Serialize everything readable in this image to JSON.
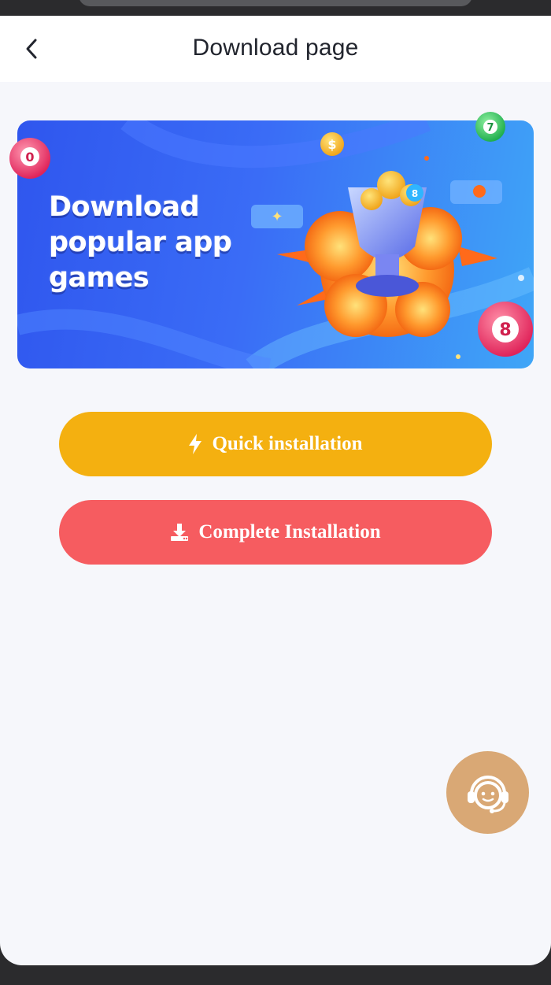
{
  "header": {
    "title": "Download page",
    "back_icon": "chevron-left-icon"
  },
  "banner": {
    "line1": "Download",
    "line2": "popular app",
    "line3": "games",
    "ball_left_number": "0",
    "ball_top_number": "7",
    "ball_right_number": "8",
    "coin_symbol": "$",
    "trophy_ball_number": "8"
  },
  "actions": {
    "quick_label": "Quick installation",
    "quick_icon": "lightning-icon",
    "complete_label": "Complete Installation",
    "complete_icon": "download-icon"
  },
  "support": {
    "icon": "customer-service-icon"
  },
  "colors": {
    "header_bg": "#ffffff",
    "page_bg": "#f6f7fb",
    "quick_button": "#f4b010",
    "complete_button": "#f65c60",
    "support_button": "#d9a875",
    "banner_blue": "#3a6cf6"
  }
}
